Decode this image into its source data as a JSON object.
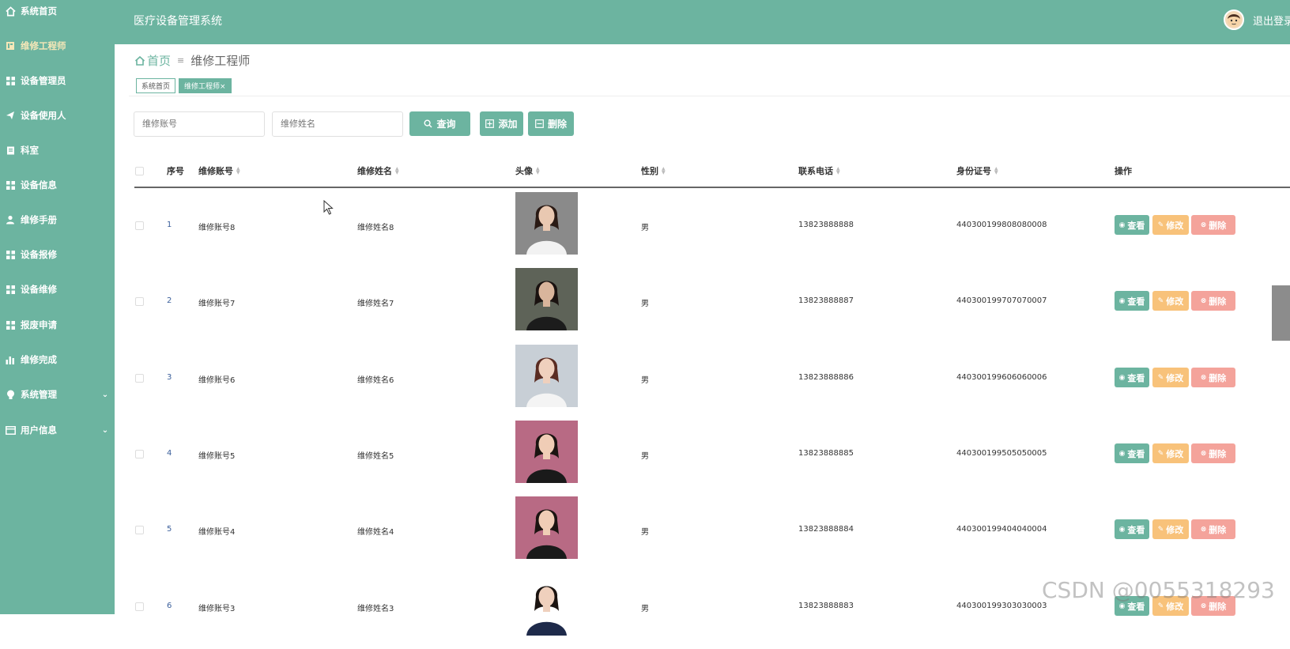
{
  "sidebar": {
    "items": [
      {
        "label": "系统首页",
        "icon": "home-icon"
      },
      {
        "label": "维修工程师",
        "icon": "book-icon"
      },
      {
        "label": "设备管理员",
        "icon": "grid-icon"
      },
      {
        "label": "设备使用人",
        "icon": "send-icon"
      },
      {
        "label": "科室",
        "icon": "clipboard-icon"
      },
      {
        "label": "设备信息",
        "icon": "grid-icon"
      },
      {
        "label": "维修手册",
        "icon": "user-icon"
      },
      {
        "label": "设备报修",
        "icon": "grid-icon"
      },
      {
        "label": "设备维修",
        "icon": "grid-icon"
      },
      {
        "label": "报废申请",
        "icon": "grid-icon"
      },
      {
        "label": "维修完成",
        "icon": "bar-chart-icon"
      },
      {
        "label": "系统管理",
        "icon": "bulb-icon"
      },
      {
        "label": "用户信息",
        "icon": "card-icon"
      }
    ]
  },
  "header": {
    "title": "医疗设备管理系统",
    "logout": "退出登录"
  },
  "breadcrumb": {
    "home": "首页",
    "separator": "≡",
    "current": "维修工程师"
  },
  "tabs": [
    {
      "label": "系统首页"
    },
    {
      "label": "维修工程师×"
    }
  ],
  "search": {
    "account_placeholder": "维修账号",
    "name_placeholder": "维修姓名",
    "query_label": "查询",
    "add_label": "添加",
    "delete_label": "删除"
  },
  "table": {
    "headers": {
      "index": "序号",
      "account": "维修账号",
      "name": "维修姓名",
      "avatar": "头像",
      "gender": "性别",
      "phone": "联系电话",
      "idcard": "身份证号",
      "ops": "操作"
    },
    "ops": {
      "view": "查看",
      "edit": "修改",
      "delete": "删除"
    },
    "rows": [
      {
        "index": "1",
        "account": "维修账号8",
        "name": "维修姓名8",
        "gender": "男",
        "phone": "13823888888",
        "idcard": "440300199808080008"
      },
      {
        "index": "2",
        "account": "维修账号7",
        "name": "维修姓名7",
        "gender": "男",
        "phone": "13823888887",
        "idcard": "440300199707070007"
      },
      {
        "index": "3",
        "account": "维修账号6",
        "name": "维修姓名6",
        "gender": "男",
        "phone": "13823888886",
        "idcard": "440300199606060006"
      },
      {
        "index": "4",
        "account": "维修账号5",
        "name": "维修姓名5",
        "gender": "男",
        "phone": "13823888885",
        "idcard": "440300199505050005"
      },
      {
        "index": "5",
        "account": "维修账号4",
        "name": "维修姓名4",
        "gender": "男",
        "phone": "13823888884",
        "idcard": "440300199404040004"
      },
      {
        "index": "6",
        "account": "维修账号3",
        "name": "维修姓名3",
        "gender": "男",
        "phone": "13823888883",
        "idcard": "440300199303030003"
      }
    ]
  },
  "watermark": "CSDN @0055318293",
  "colors": {
    "primary": "#6cb4a0",
    "edit": "#f8c27a",
    "delete": "#f4a39b"
  }
}
